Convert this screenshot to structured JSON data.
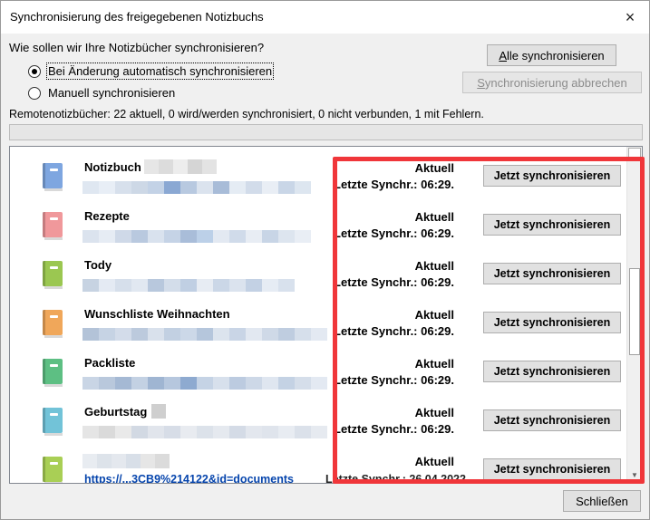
{
  "window": {
    "title": "Synchronisierung des freigegebenen Notizbuchs"
  },
  "question": "Wie sollen wir Ihre Notizbücher synchronisieren?",
  "options": [
    {
      "label": "Bei Änderung automatisch synchronisieren",
      "checked": true
    },
    {
      "label": "Manuell synchronisieren",
      "checked": false
    }
  ],
  "buttons": {
    "sync_all_first": "A",
    "sync_all_rest": "lle synchronisieren",
    "cancel_first": "S",
    "cancel_rest": "ynchronisierung abbrechen",
    "close": "Schließen"
  },
  "remote_status": "Remotenotizbücher: 22 aktuell, 0 wird/werden synchronisiert, 0 nicht verbunden, 1 mit Fehlern.",
  "notebooks": [
    {
      "name": "Notizbuch",
      "status": "Aktuell",
      "last_sync": "Letzte Synchr.: 06:29.",
      "button": "Jetzt synchronisieren",
      "color": "#7ea6e0"
    },
    {
      "name": "Rezepte",
      "status": "Aktuell",
      "last_sync": "Letzte Synchr.: 06:29.",
      "button": "Jetzt synchronisieren",
      "color": "#f0989b"
    },
    {
      "name": "Tody",
      "status": "Aktuell",
      "last_sync": "Letzte Synchr.: 06:29.",
      "button": "Jetzt synchronisieren",
      "color": "#9bc751"
    },
    {
      "name": "Wunschliste Weihnachten",
      "status": "Aktuell",
      "last_sync": "Letzte Synchr.: 06:29.",
      "button": "Jetzt synchronisieren",
      "color": "#f0a75a"
    },
    {
      "name": "Packliste",
      "status": "Aktuell",
      "last_sync": "Letzte Synchr.: 06:29.",
      "button": "Jetzt synchronisieren",
      "color": "#5dbf83"
    },
    {
      "name": "Geburtstag",
      "status": "Aktuell",
      "last_sync": "Letzte Synchr.: 06:29.",
      "button": "Jetzt synchronisieren",
      "color": "#72c3d8"
    },
    {
      "name": "",
      "status": "Aktuell",
      "last_sync": "",
      "button": "Jetzt synchronisieren",
      "color": "#a9cf55",
      "link": "https://...3CB9%214122&id=documents",
      "date": "Letzte Synchr.: 26.04.2022"
    }
  ],
  "icons": {
    "close": "×",
    "scroll_down": "▼"
  }
}
